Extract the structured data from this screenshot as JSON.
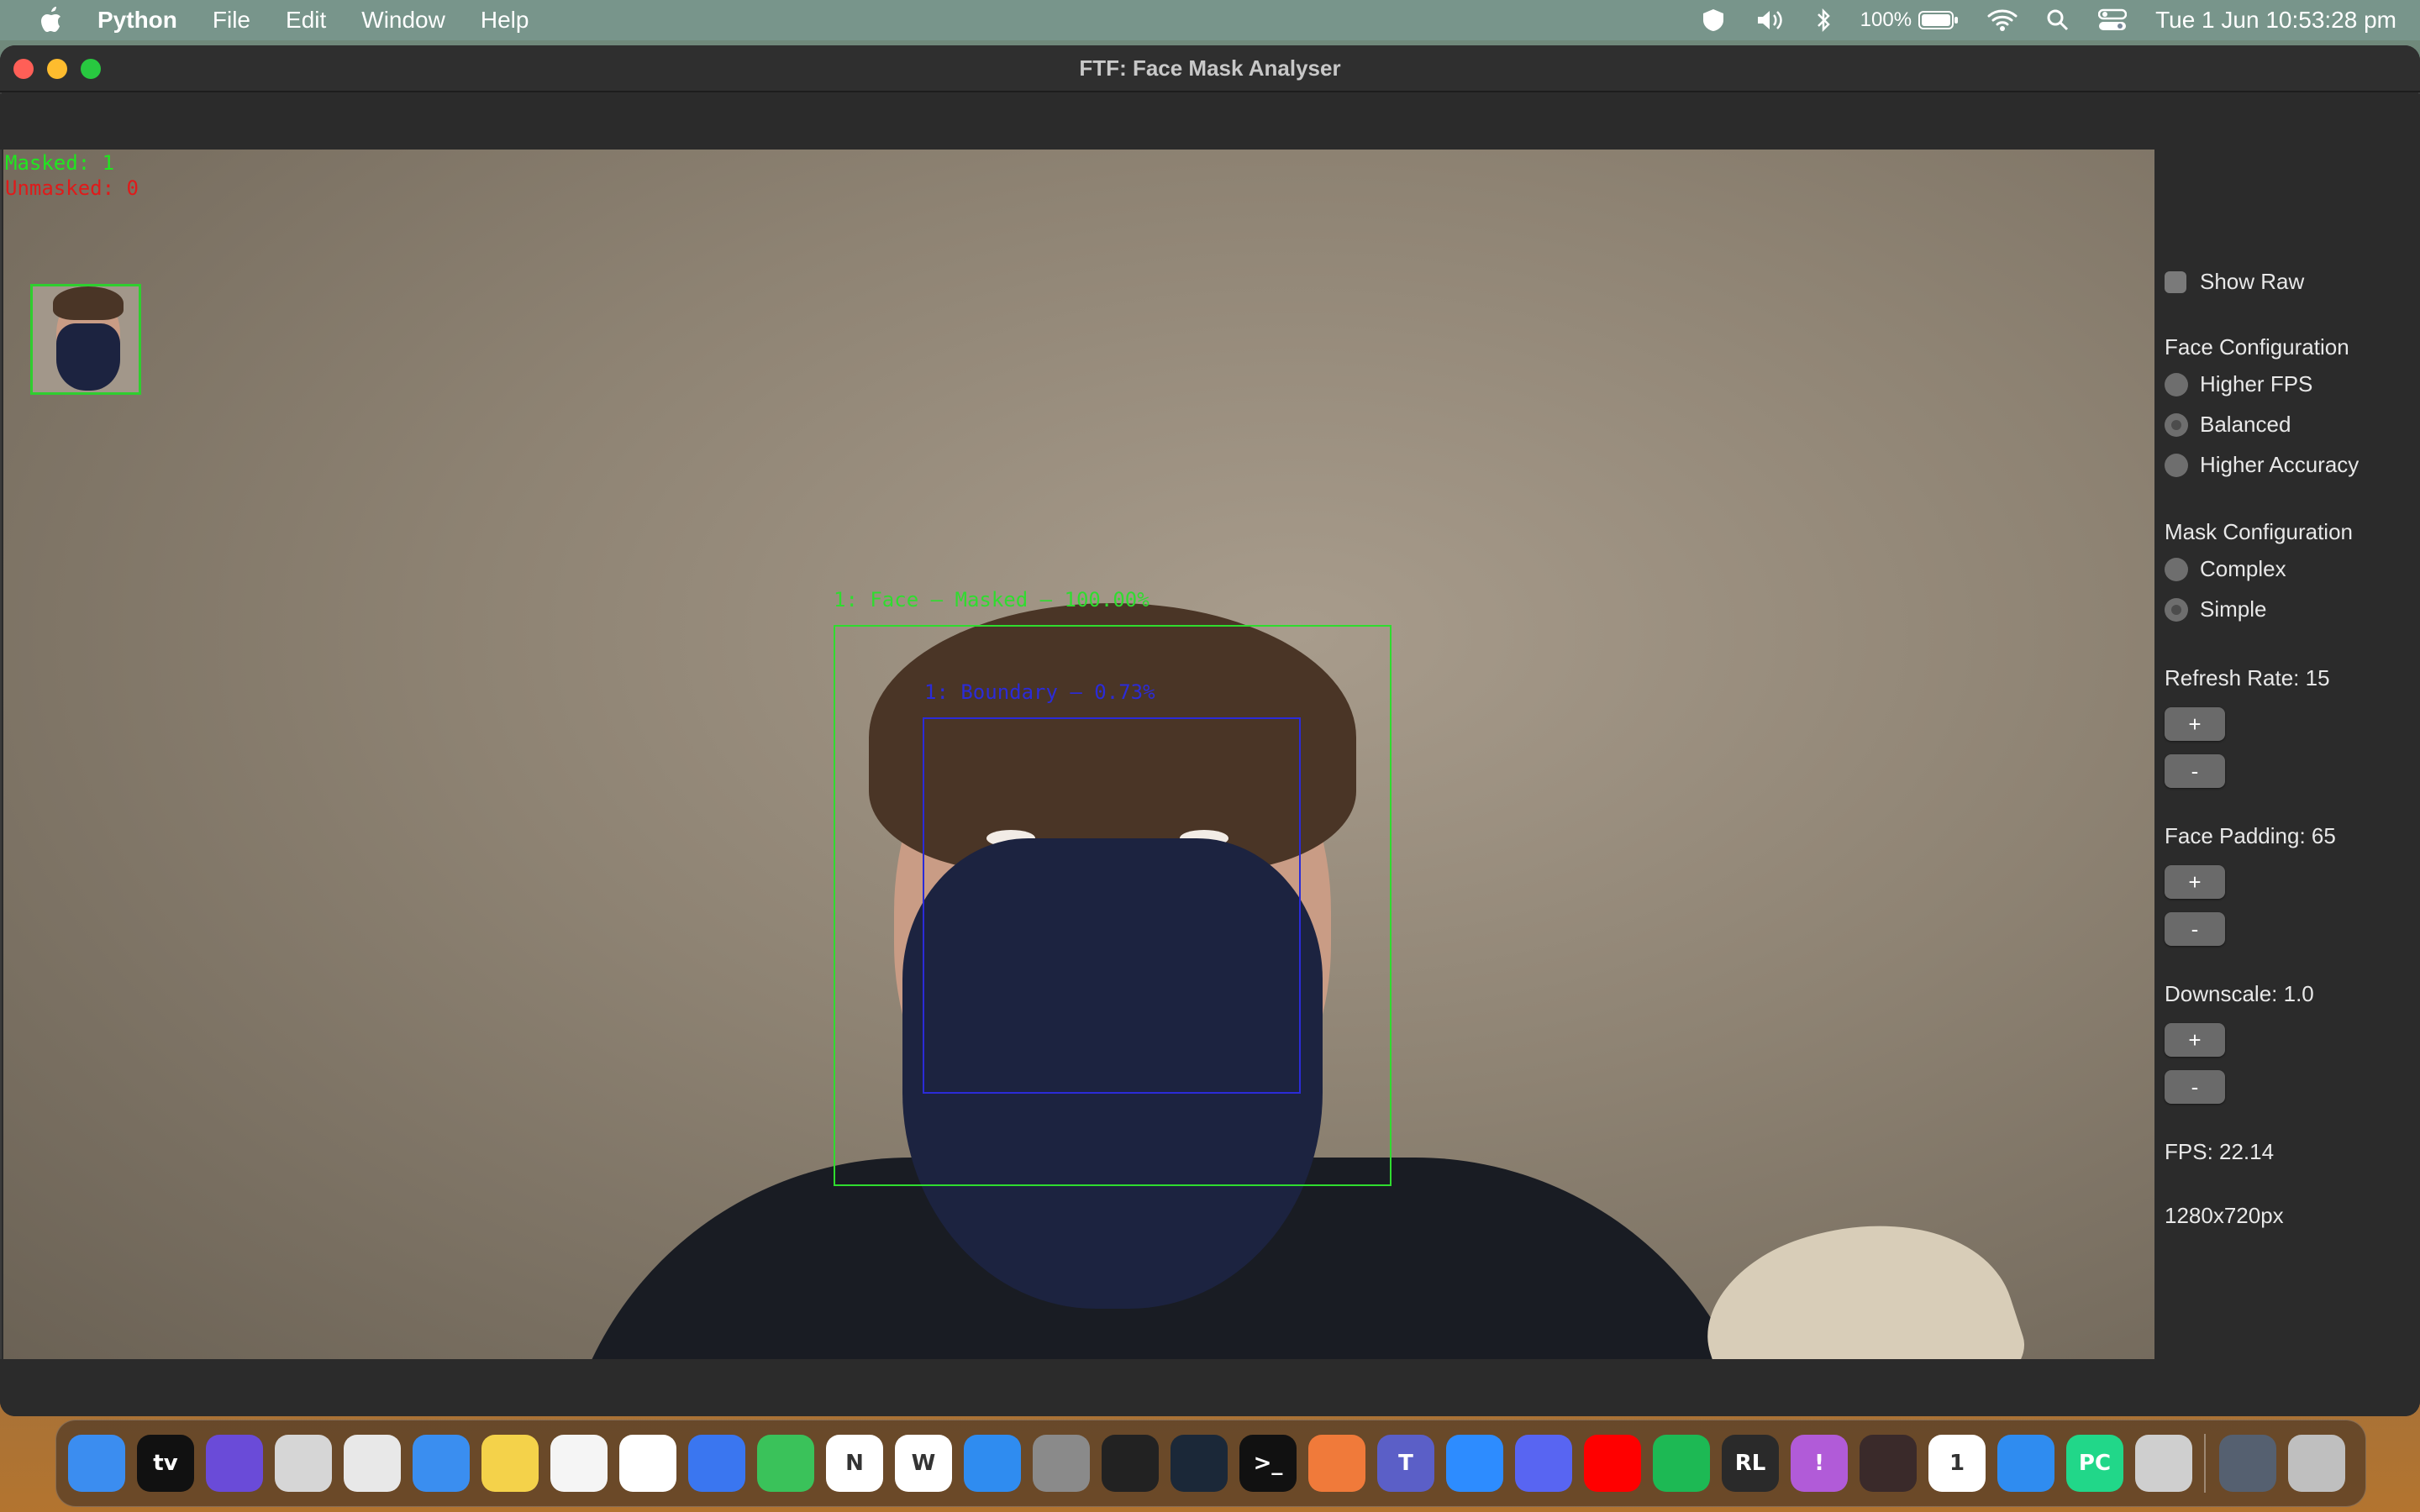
{
  "menubar": {
    "app_name": "Python",
    "menus": [
      "File",
      "Edit",
      "Window",
      "Help"
    ],
    "battery": "100%",
    "datetime": "Tue 1 Jun  10:53:28 pm"
  },
  "window": {
    "title": "FTF: Face Mask Analyser"
  },
  "video": {
    "masked_count": "Masked: 1",
    "unmasked_count": "Unmasked: 0",
    "face_label": "1: Face — Masked — 100.00%",
    "boundary_label": "1: Boundary — 0.73%",
    "colors": {
      "masked": "#1fe81f",
      "unmasked": "#e01a1a",
      "boundary": "#2b2bd8"
    }
  },
  "panel": {
    "show_raw_label": "Show Raw",
    "face_config": {
      "title": "Face Configuration",
      "options": [
        "Higher FPS",
        "Balanced",
        "Higher Accuracy"
      ],
      "selected": "Balanced"
    },
    "mask_config": {
      "title": "Mask Configuration",
      "options": [
        "Complex",
        "Simple"
      ],
      "selected": "Simple"
    },
    "refresh_rate": "Refresh Rate: 15",
    "face_padding": "Face Padding: 65",
    "downscale": "Downscale: 1.0",
    "plus": "+",
    "minus": "-",
    "fps": "FPS: 22.14",
    "resolution": "1280x720px"
  },
  "dock": {
    "apps": [
      {
        "name": "finder-icon",
        "color": "#3b8df0",
        "glyph": ""
      },
      {
        "name": "apple-tv-icon",
        "color": "#111111",
        "glyph": "tv"
      },
      {
        "name": "siri-icon",
        "color": "#6a4bd8",
        "glyph": ""
      },
      {
        "name": "launchpad-icon",
        "color": "#d6d6d6",
        "glyph": ""
      },
      {
        "name": "chrome-icon",
        "color": "#e8e8e8",
        "glyph": ""
      },
      {
        "name": "mail-icon",
        "color": "#3a8ef0",
        "glyph": ""
      },
      {
        "name": "notes-icon",
        "color": "#f4d24a",
        "glyph": ""
      },
      {
        "name": "photos-icon",
        "color": "#f5f5f5",
        "glyph": ""
      },
      {
        "name": "messenger-icon",
        "color": "#ffffff",
        "glyph": ""
      },
      {
        "name": "signal-icon",
        "color": "#3a76f0",
        "glyph": ""
      },
      {
        "name": "messages-icon",
        "color": "#3ac25a",
        "glyph": ""
      },
      {
        "name": "onenote-icon",
        "color": "#ffffff",
        "glyph": "N"
      },
      {
        "name": "word-icon",
        "color": "#ffffff",
        "glyph": "W"
      },
      {
        "name": "app-store-icon",
        "color": "#2f8cf0",
        "glyph": ""
      },
      {
        "name": "system-preferences-icon",
        "color": "#8a8a8a",
        "glyph": ""
      },
      {
        "name": "audio-meter-icon",
        "color": "#222222",
        "glyph": ""
      },
      {
        "name": "steam-icon",
        "color": "#1b2838",
        "glyph": ""
      },
      {
        "name": "terminal-icon",
        "color": "#111111",
        "glyph": ">_"
      },
      {
        "name": "pencil-app-icon",
        "color": "#f07a3a",
        "glyph": ""
      },
      {
        "name": "teams-icon",
        "color": "#5b5fc7",
        "glyph": "T"
      },
      {
        "name": "zoom-icon",
        "color": "#2d8cff",
        "glyph": ""
      },
      {
        "name": "discord-icon",
        "color": "#5865f2",
        "glyph": ""
      },
      {
        "name": "youtube-music-icon",
        "color": "#ff0000",
        "glyph": ""
      },
      {
        "name": "spotify-icon",
        "color": "#1db954",
        "glyph": ""
      },
      {
        "name": "rocket-league-icon",
        "color": "#2a2a2a",
        "glyph": "RL"
      },
      {
        "name": "feedback-icon",
        "color": "#b15bd8",
        "glyph": "!"
      },
      {
        "name": "graph-app-icon",
        "color": "#3a2a2a",
        "glyph": ""
      },
      {
        "name": "calendar-icon",
        "color": "#ffffff",
        "glyph": "1"
      },
      {
        "name": "todo-icon",
        "color": "#2f8cf0",
        "glyph": ""
      },
      {
        "name": "pycharm-icon",
        "color": "#21d789",
        "glyph": "PC"
      },
      {
        "name": "rocket-icon",
        "color": "#cfcfcf",
        "glyph": ""
      },
      {
        "name": "downloads-stack-icon",
        "color": "#556070",
        "glyph": ""
      },
      {
        "name": "trash-icon",
        "color": "#bfbfbf",
        "glyph": ""
      }
    ]
  }
}
